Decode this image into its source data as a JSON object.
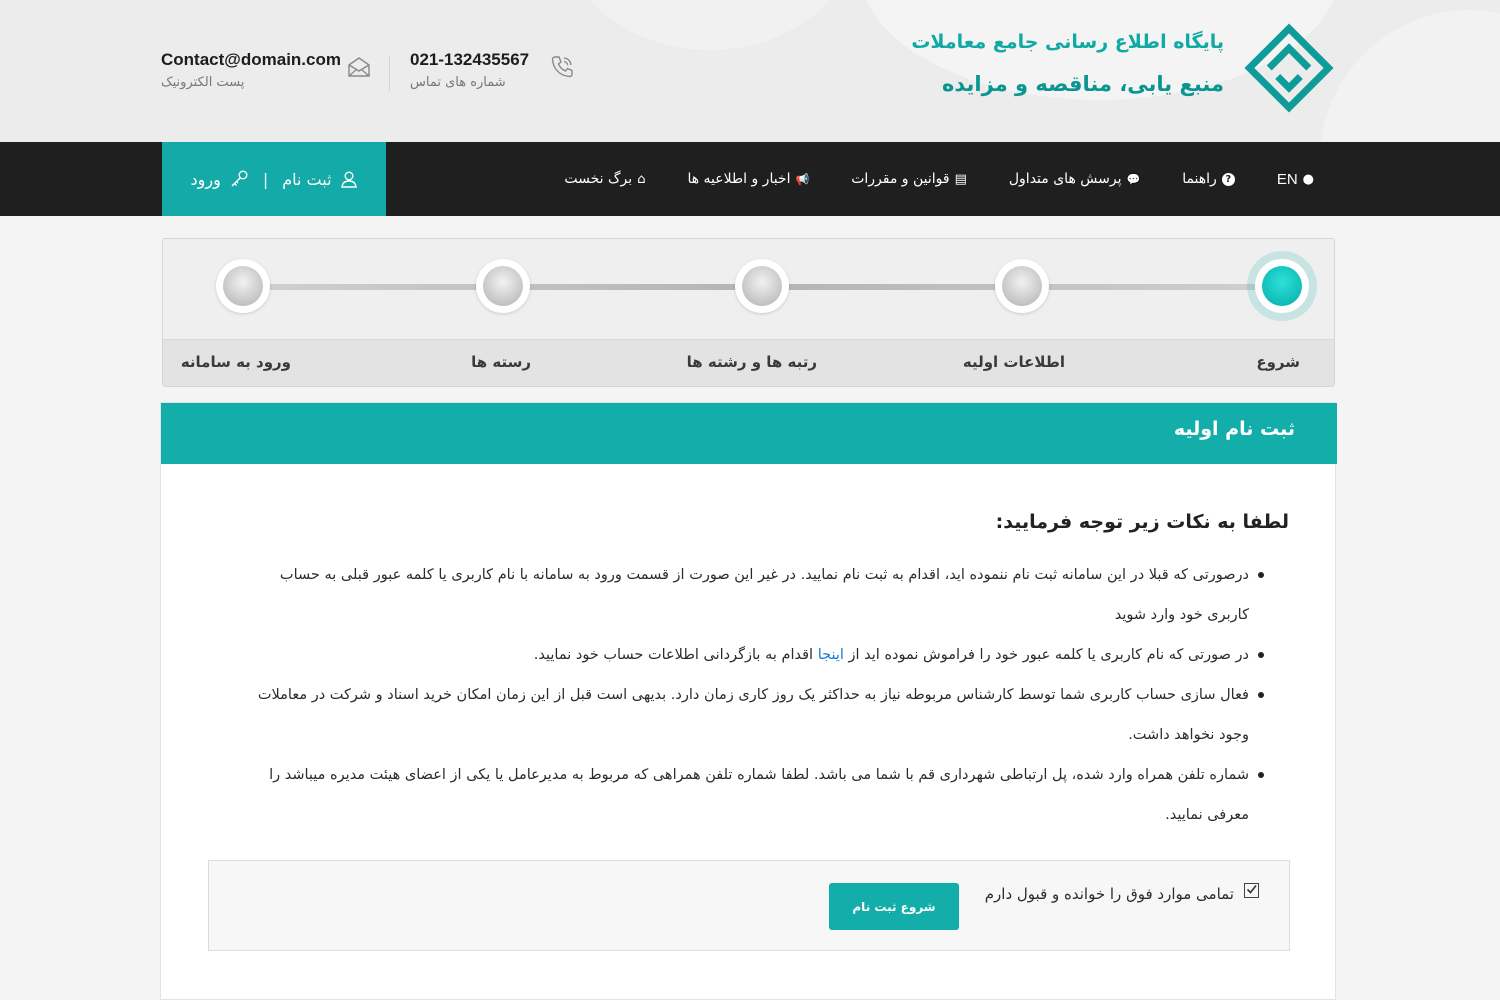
{
  "header": {
    "logo_line1": "پایگاه اطلاع رسانی جامع معاملات",
    "logo_line2": "منبع یابی، مناقصه و مزایده",
    "phone_value": "021-132435567",
    "phone_label": "شماره های تماس",
    "email_value": "Contact@domain.com",
    "email_label": "پست الکترونیک"
  },
  "nav": {
    "items": [
      {
        "label": "برگ نخست",
        "icon": "home-icon",
        "glyph": "⌂"
      },
      {
        "label": "اخبار و اطلاعیه ها",
        "icon": "megaphone-icon",
        "glyph": "📢"
      },
      {
        "label": "قوانین و مقررات",
        "icon": "book-icon",
        "glyph": "▤"
      },
      {
        "label": "پرسش های متداول",
        "icon": "comments-icon",
        "glyph": "💬"
      },
      {
        "label": "راهنما",
        "icon": "question-circle-icon",
        "glyph": "?"
      },
      {
        "label": "EN",
        "icon": "globe-icon",
        "glyph": "●"
      }
    ],
    "login_label": "ورود",
    "separator": "|",
    "register_label": "ثبت نام"
  },
  "stepper": {
    "steps": [
      "شروع",
      "اطلاعات اولیه",
      "رتبه ها و رشته ها",
      "رسته ها",
      "ورود به سامانه"
    ],
    "active_index": 0
  },
  "panel": {
    "title": "ثبت نام اولیه",
    "notes_title": "لطفا به نکات زیر توجه فرمایید:",
    "notes": [
      {
        "text": "درصورتی که قبلا در این سامانه ثبت نام ننموده اید، اقدام به ثبت نام نمایید. در غیر این صورت از قسمت ورود به سامانه با نام کاربری یا کلمه عبور قبلی به حساب کاربری خود وارد شوید"
      },
      {
        "before": "در صورتی که نام کاربری یا کلمه عبور خود را فراموش نموده اید از ",
        "link": "اینجا",
        "after": " اقدام به بازگردانی اطلاعات حساب خود نمایید."
      },
      {
        "text": "فعال سازی حساب کاربری شما توسط کارشناس مربوطه نیاز به حداکثر یک روز کاری زمان دارد. بدیهی است قبل از این زمان امکان خرید اسناد و شرکت در معاملات وجود نخواهد داشت."
      },
      {
        "text": "شماره تلفن همراه وارد شده، پل ارتباطی شهرداری قم با شما می باشد. لطفا شماره تلفن همراهی که مربوط به مدیرعامل یا یکی از اعضای هیئت مدیره میباشد را معرفی نمایید."
      }
    ],
    "accept_label": "تمامی موارد فوق را خوانده و قبول دارم",
    "accept_checked": true,
    "start_button": "شروع ثبت نام"
  },
  "colors": {
    "accent": "#13aea9",
    "nav_bg": "#1f1f1f",
    "link": "#1a7bd6"
  }
}
